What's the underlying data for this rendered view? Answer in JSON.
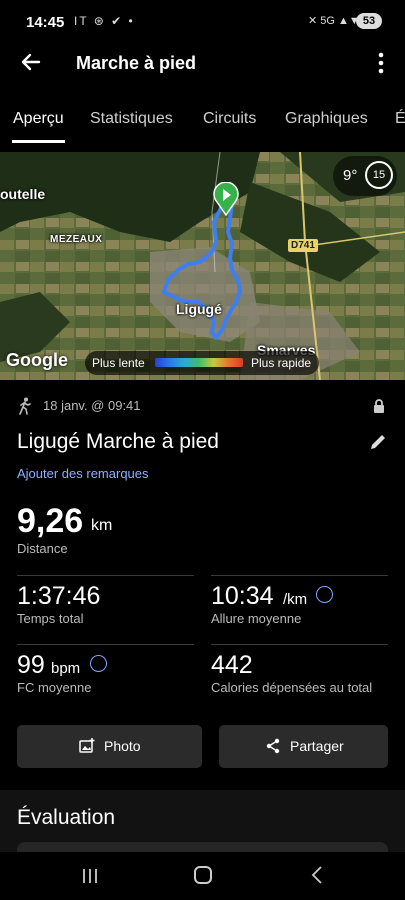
{
  "status_bar": {
    "time": "14:45",
    "left_icons": "IT ⊛ ✔ •",
    "right_icons": "✕ 5G ▲▼ ▮▮",
    "battery": "53"
  },
  "app_bar": {
    "title": "Marche à pied"
  },
  "tabs": [
    {
      "label": "Aperçu",
      "active": true
    },
    {
      "label": "Statistiques",
      "active": false
    },
    {
      "label": "Circuits",
      "active": false
    },
    {
      "label": "Graphiques",
      "active": false
    },
    {
      "label": "É",
      "active": false
    }
  ],
  "map": {
    "places": {
      "outelle": "outelle",
      "mezeaux": "MEZEAUX",
      "liguge": "Ligugé",
      "smarves": "Smarves"
    },
    "road": "D741",
    "weather_temp": "9°",
    "weather_dial": "15",
    "provider": "Google",
    "legend_slow": "Plus lente",
    "legend_fast": "Plus rapide",
    "route_color": "#3d7ff0",
    "start_color": "#36b24a"
  },
  "activity": {
    "date": "18 janv. @ 09:41",
    "title": "Ligugé Marche à pied",
    "remarks_link": "Ajouter des remarques",
    "distance": {
      "value": "9,26",
      "unit": "km",
      "label": "Distance"
    },
    "total_time": {
      "value": "1:37:46",
      "label": "Temps total"
    },
    "pace": {
      "value": "10:34",
      "unit": "/km",
      "label": "Allure moyenne"
    },
    "heart_rate": {
      "value": "99",
      "unit": "bpm",
      "label": "FC moyenne"
    },
    "calories": {
      "value": "442",
      "label": "Calories dépensées au total"
    }
  },
  "buttons": {
    "photo": "Photo",
    "share": "Partager"
  },
  "evaluation": {
    "title": "Évaluation"
  },
  "colors": {
    "accent_link": "#8fb0ff",
    "background": "#000000",
    "card": "#2b2b2b"
  }
}
